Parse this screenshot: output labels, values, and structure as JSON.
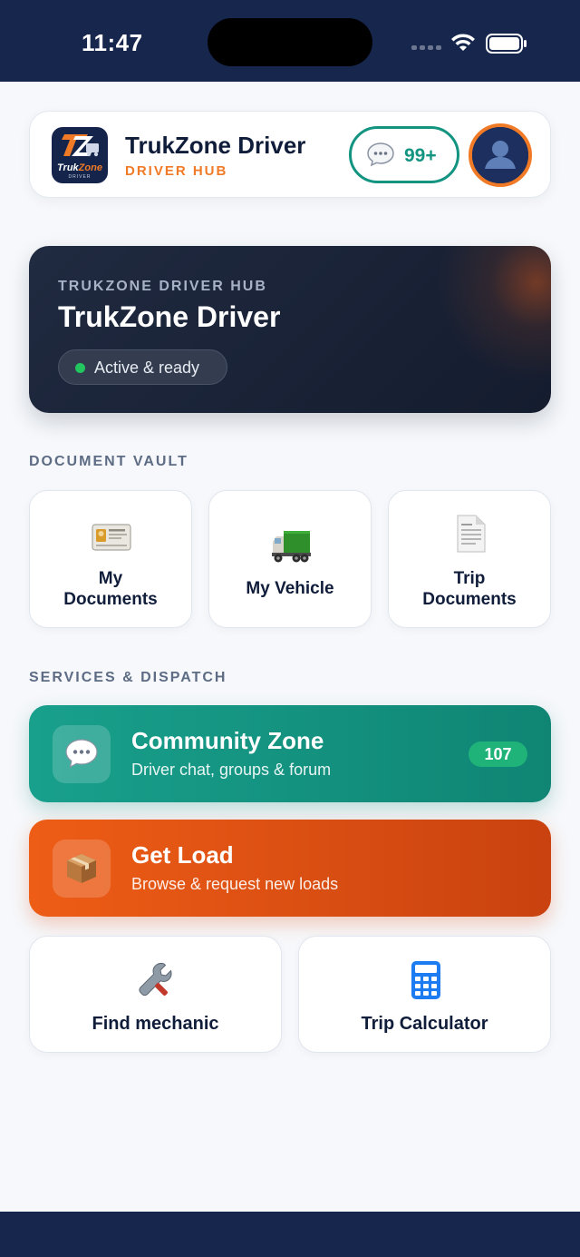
{
  "status_bar": {
    "time": "11:47"
  },
  "header": {
    "logo_text_a": "Truk",
    "logo_text_b": "Zone",
    "logo_sub": "DRIVER",
    "title": "TrukZone Driver",
    "subtitle": "DRIVER HUB",
    "message_count": "99+"
  },
  "hero": {
    "eyebrow": "TRUKZONE DRIVER HUB",
    "title": "TrukZone Driver",
    "status": "Active & ready"
  },
  "document_vault": {
    "label": "DOCUMENT VAULT",
    "tiles": [
      {
        "label_line1": "My",
        "label_line2": "Documents",
        "icon": "id-card-icon"
      },
      {
        "label": "My Vehicle",
        "icon": "truck-icon"
      },
      {
        "label_line1": "Trip",
        "label_line2": "Documents",
        "icon": "document-icon"
      }
    ]
  },
  "services": {
    "label": "SERVICES & DISPATCH",
    "community": {
      "title": "Community Zone",
      "subtitle": "Driver chat, groups & forum",
      "badge": "107",
      "icon": "chat-bubble-icon"
    },
    "get_load": {
      "title": "Get Load",
      "subtitle": "Browse & request new loads",
      "icon": "package-icon"
    },
    "tools": [
      {
        "label": "Find mechanic",
        "icon": "wrench-icon"
      },
      {
        "label": "Trip Calculator",
        "icon": "calculator-icon"
      }
    ]
  },
  "colors": {
    "navy": "#17264d",
    "accent_orange": "#f07a26",
    "teal": "#129481",
    "status_green": "#22c55e"
  }
}
